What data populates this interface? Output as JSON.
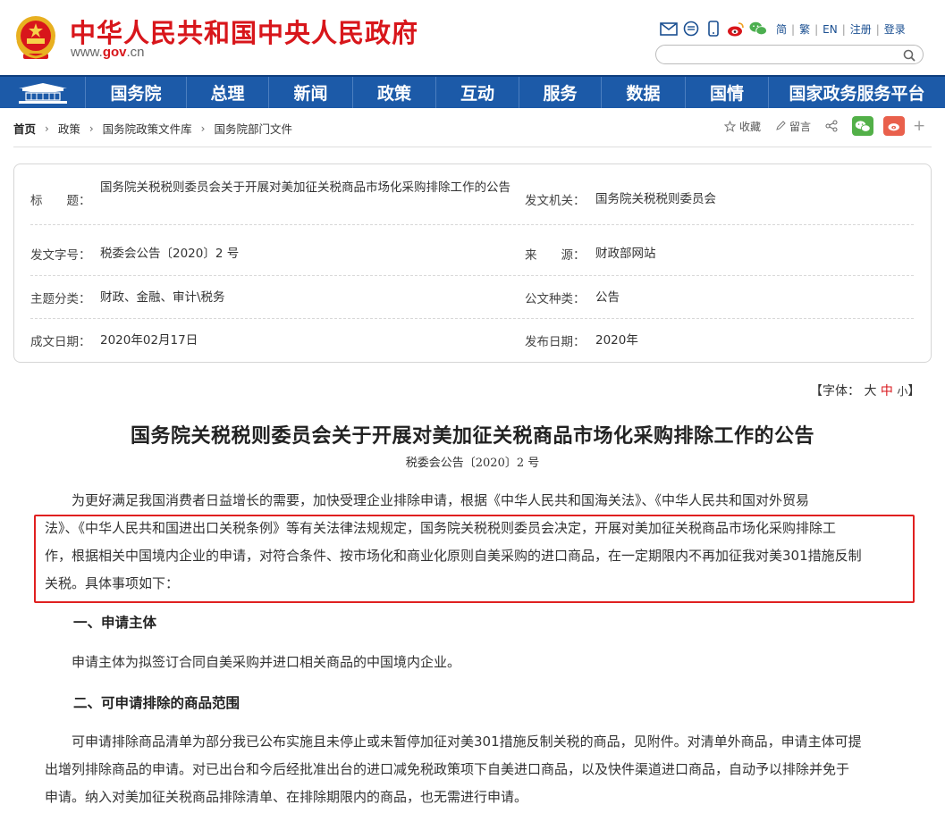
{
  "header": {
    "site_title": "中华人民共和国中央人民政府",
    "site_url_prefix": "www.",
    "site_url_domain": "gov",
    "site_url_suffix": ".cn",
    "links": [
      "简",
      "繁",
      "EN",
      "注册",
      "登录"
    ],
    "icons": [
      "mail-icon",
      "message-icon",
      "mobile-icon",
      "weibo-icon",
      "wechat-icon"
    ],
    "search_placeholder": ""
  },
  "nav": {
    "items": [
      "国务院",
      "总理",
      "新闻",
      "政策",
      "互动",
      "服务",
      "数据",
      "国情",
      "国家政务服务平台"
    ]
  },
  "breadcrumb": {
    "items": [
      "首页",
      "政策",
      "国务院政策文件库",
      "国务院部门文件"
    ]
  },
  "tools": {
    "favorite": "收藏",
    "comment": "留言"
  },
  "info": {
    "title_label": "标　　题：",
    "title_value": "国务院关税税则委员会关于开展对美加征关税商品市场化采购排除工作的公告",
    "issuer_label": "发文机关：",
    "issuer_value": "国务院关税税则委员会",
    "docno_label": "发文字号：",
    "docno_value": "税委会公告〔2020〕2 号",
    "source_label": "来　　源：",
    "source_value": "财政部网站",
    "topic_label": "主题分类：",
    "topic_value": "财政、金融、审计\\税务",
    "type_label": "公文种类：",
    "type_value": "公告",
    "written_label": "成文日期：",
    "written_value": "2020年02月17日",
    "published_label": "发布日期：",
    "published_value": "2020年"
  },
  "fontsize": {
    "prefix": "【字体：",
    "large": "大",
    "medium": "中",
    "small": "小",
    "suffix": "】"
  },
  "article": {
    "title": "国务院关税税则委员会关于开展对美加征关税商品市场化采购排除工作的公告",
    "subtitle": "税委会公告〔2020〕2 号",
    "p1_line1": "为更好满足我国消费者日益增长的需要，加快受理企业排除申请，根据《中华人民共和国海关法》、《中华人民共和国对外贸易",
    "p1_line2": "法》、《中华人民共和国进出口关税条例》等有关法律法规规定，国务院关税税则委员会决定，开展对美加征关税商品市场化采购排除工",
    "p1_line3": "作，根据相关中国境内企业的申请，对符合条件、按市场化和商业化原则自美采购的进口商品，在一定期限内不再加征我对美301措施反制",
    "p1_line4": "关税。具体事项如下：",
    "h1": "一、申请主体",
    "p2": "申请主体为拟签订合同自美采购并进口相关商品的中国境内企业。",
    "h2": "二、可申请排除的商品范围",
    "p3_line1": "可申请排除商品清单为部分我已公布实施且未停止或未暂停加征对美301措施反制关税的商品，见附件。对清单外商品，申请主体可提",
    "p3_line2": "出增列排除商品的申请。对已出台和今后经批准出台的进口减免税政策项下自美进口商品，以及快件渠道进口商品，自动予以排除并免于",
    "p3_line3": "申请。纳入对美加征关税商品排除清单、在排除期限内的商品，也无需进行申请。"
  },
  "colors": {
    "brand_red": "#d8161b",
    "nav_blue": "#1c5aa8",
    "highlight_red": "#e02020"
  }
}
